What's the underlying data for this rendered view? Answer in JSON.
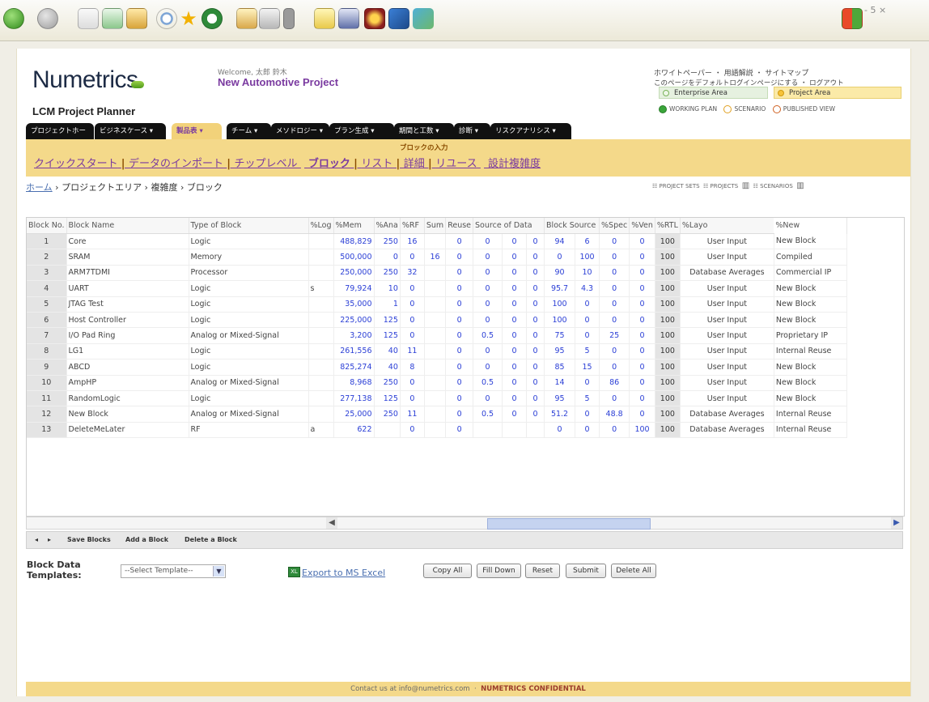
{
  "browser": {
    "controls": "- 5 ×",
    "icons": [
      "back-icon",
      "forward-icon",
      "stop-icon",
      "refresh-icon",
      "home-icon",
      "search-icon",
      "favorites-icon",
      "history-icon",
      "mail-icon",
      "print-icon",
      "edit-icon",
      "folder-icon",
      "media-icon",
      "toolbar-icon",
      "windows-logo-icon"
    ]
  },
  "header": {
    "logo": "Numetrics",
    "welcome": "Welcome, 太郎 鈴木",
    "project": "New Automotive Project",
    "app_title": "LCM Project Planner",
    "top_links": "ホワイトペーパー ・ 用語解説 ・ サイトマップ",
    "top_links2": "このページをデフォルトログインページにする ・ ログアウト",
    "enterprise_area": "Enterprise Area",
    "project_area": "Project Area",
    "view_working": "WORKING PLAN",
    "view_scenario": "SCENARIO",
    "view_published": "PUBLISHED VIEW"
  },
  "nav": [
    {
      "label": "プロジェクトホーム ▾"
    },
    {
      "label": "ビジネスケース ▾"
    },
    {
      "label": "製品表 ▾"
    },
    {
      "label": "チーム ▾"
    },
    {
      "label": "メソドロジー ▾"
    },
    {
      "label": "プラン生成 ▾"
    },
    {
      "label": "期間と工数 ▾"
    },
    {
      "label": "診断 ▾"
    },
    {
      "label": "リスクアナリシス ▾"
    }
  ],
  "subnav": {
    "title": "ブロックの入力",
    "links": [
      "クイックスタート",
      "データのインポート",
      "チップレベル",
      "ブロック",
      "リスト",
      "詳細",
      "リユース",
      "設計複雑度"
    ]
  },
  "breadcrumb": {
    "home": "ホーム",
    "rest": " › プロジェクトエリア › 複雑度 › ブロック"
  },
  "view_modes": {
    "project_sets": "PROJECT SETS",
    "projects": "PROJECTS",
    "scenarios": "SCENARIOS"
  },
  "grid": {
    "columns": [
      "Block No.",
      "Block Name",
      "Type of Block",
      "%Log",
      "%Mem",
      "%Ana",
      "%RF",
      "Sum",
      "Reuse",
      "Source of Data",
      "Block Source",
      "",
      "%Spec",
      "%Ven",
      "%RTL",
      "%Layo",
      "%New"
    ],
    "rows": [
      [
        "1",
        "Core",
        "Logic",
        "",
        "488,829",
        "250",
        "16",
        "",
        "0",
        "0",
        "0",
        "0",
        "94",
        "6",
        "0",
        "0",
        "100",
        "User Input",
        "New Block"
      ],
      [
        "2",
        "SRAM",
        "Memory",
        "",
        "500,000",
        "0",
        "0",
        "16",
        "0",
        "0",
        "0",
        "0",
        "0",
        "100",
        "0",
        "0",
        "100",
        "User Input",
        "Compiled"
      ],
      [
        "3",
        "ARM7TDMI",
        "Processor",
        "",
        "250,000",
        "250",
        "32",
        "",
        "0",
        "0",
        "0",
        "0",
        "90",
        "10",
        "0",
        "0",
        "100",
        "Database Averages",
        "Commercial IP"
      ],
      [
        "4",
        "UART",
        "Logic",
        "s",
        "79,924",
        "10",
        "0",
        "",
        "0",
        "0",
        "0",
        "0",
        "95.7",
        "4.3",
        "0",
        "0",
        "100",
        "User Input",
        "New Block"
      ],
      [
        "5",
        "JTAG Test",
        "Logic",
        "",
        "35,000",
        "1",
        "0",
        "",
        "0",
        "0",
        "0",
        "0",
        "100",
        "0",
        "0",
        "0",
        "100",
        "User Input",
        "New Block"
      ],
      [
        "6",
        "Host Controller",
        "Logic",
        "",
        "225,000",
        "125",
        "0",
        "",
        "0",
        "0",
        "0",
        "0",
        "100",
        "0",
        "0",
        "0",
        "100",
        "User Input",
        "New Block"
      ],
      [
        "7",
        "I/O Pad Ring",
        "Analog or Mixed-Signal",
        "",
        "3,200",
        "125",
        "0",
        "",
        "0",
        "0.5",
        "0",
        "0",
        "75",
        "0",
        "25",
        "0",
        "100",
        "User Input",
        "Proprietary IP"
      ],
      [
        "8",
        "LG1",
        "Logic",
        "",
        "261,556",
        "40",
        "11",
        "",
        "0",
        "0",
        "0",
        "0",
        "95",
        "5",
        "0",
        "0",
        "100",
        "User Input",
        "Internal Reuse"
      ],
      [
        "9",
        "ABCD",
        "Logic",
        "",
        "825,274",
        "40",
        "8",
        "",
        "0",
        "0",
        "0",
        "0",
        "85",
        "15",
        "0",
        "0",
        "100",
        "User Input",
        "New Block"
      ],
      [
        "10",
        "AmpHP",
        "Analog or Mixed-Signal",
        "",
        "8,968",
        "250",
        "0",
        "",
        "0",
        "0.5",
        "0",
        "0",
        "14",
        "0",
        "86",
        "0",
        "100",
        "User Input",
        "New Block"
      ],
      [
        "11",
        "RandomLogic",
        "Logic",
        "",
        "277,138",
        "125",
        "0",
        "",
        "0",
        "0",
        "0",
        "0",
        "95",
        "5",
        "0",
        "0",
        "100",
        "User Input",
        "New Block"
      ],
      [
        "12",
        "New Block",
        "Analog or Mixed-Signal",
        "",
        "25,000",
        "250",
        "11",
        "",
        "0",
        "0.5",
        "0",
        "0",
        "51.2",
        "0",
        "48.8",
        "0",
        "100",
        "Database Averages",
        "Internal Reuse"
      ],
      [
        "13",
        "DeleteMeLater",
        "RF",
        "a",
        "622",
        "",
        "0",
        "",
        "0",
        "",
        "",
        "",
        "0",
        "0",
        "0",
        "100",
        "100",
        "Database Averages",
        "Internal Reuse"
      ]
    ]
  },
  "gridbar": {
    "save": "Save Blocks",
    "add": "Add a Block",
    "delete": "Delete a Block"
  },
  "bottom": {
    "templates_label": "Block Data Templates:",
    "template_select": "--Select Template--",
    "export": "Export to MS Excel",
    "buttons": [
      "Copy All",
      "Fill Down",
      "Reset",
      "Submit",
      "Delete All"
    ]
  },
  "footer": {
    "contact": "Contact us at info@numetrics.com",
    "confidential": "NUMETRICS CONFIDENTIAL"
  },
  "colors": {
    "accent_yellow": "#f4d98a",
    "brand_purple": "#7a3aa0",
    "number_blue": "#2b3fd6",
    "nav_black": "#111111"
  }
}
